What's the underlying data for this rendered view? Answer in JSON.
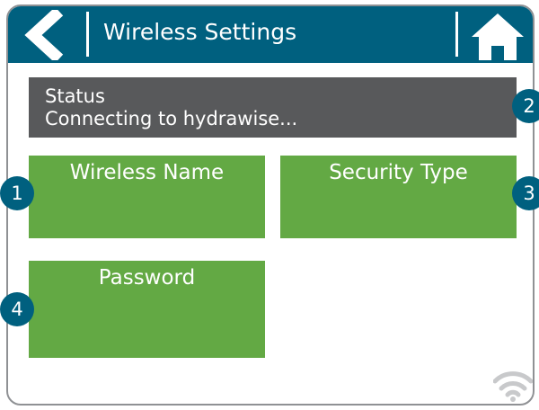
{
  "header": {
    "title": "Wireless Settings",
    "back_icon": "chevron-left-icon",
    "home_icon": "home-icon",
    "color": "#00607f"
  },
  "status": {
    "label": "Status",
    "message": "Connecting to hydrawise..."
  },
  "tiles": [
    {
      "label": "Wireless Name"
    },
    {
      "label": "Security Type"
    },
    {
      "label": "Password"
    }
  ],
  "tile_color": "#63a944",
  "footer": {
    "wifi_icon": "wifi-icon"
  },
  "callouts": [
    "1",
    "2",
    "3",
    "4"
  ]
}
